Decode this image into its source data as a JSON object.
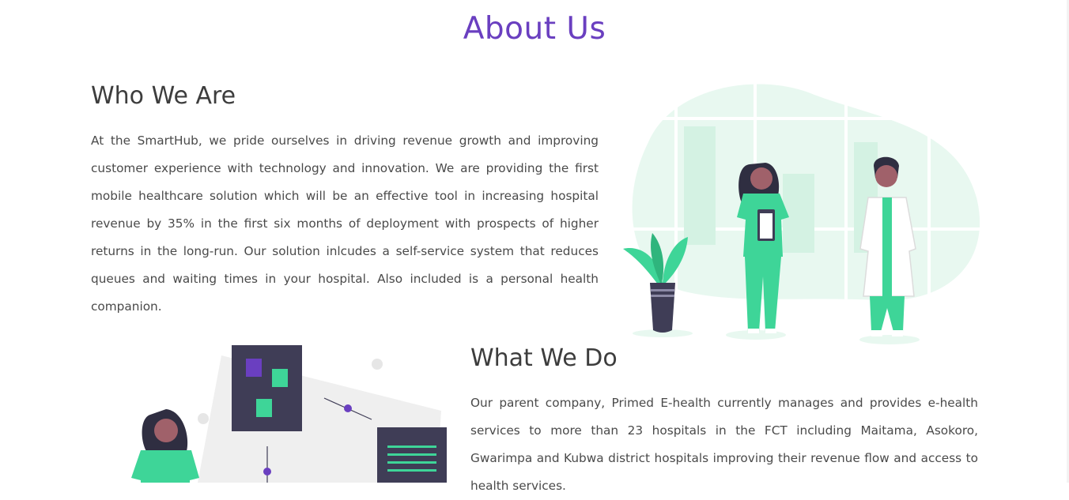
{
  "page": {
    "title": "About Us"
  },
  "who_we_are": {
    "heading": "Who We Are",
    "text": "At the SmartHub, we pride ourselves in driving revenue growth and improving customer experience with technology and innovation. We are providing the first mobile healthcare solution which will be an effective tool in increasing hospital revenue by 35% in the first six months of deployment with prospects of higher returns in the long-run. Our solution inlcudes a self-service system that reduces queues and waiting times in your hospital. Also included is a personal health companion."
  },
  "what_we_do": {
    "heading": "What We Do",
    "text": "Our parent company, Primed E-health currently manages and provides e-health services to more than 23 hospitals in the FCT including Maitama, Asokoro, Gwarimpa and Kubwa district hospitals improving their revenue flow and access to health services."
  },
  "colors": {
    "accent": "#6a3fc0",
    "scrubs": "#3ed598",
    "dark": "#3f3d56",
    "skin": "#a0616a",
    "heading_text": "#3d3d3d",
    "body_text": "#4a4a4a"
  }
}
